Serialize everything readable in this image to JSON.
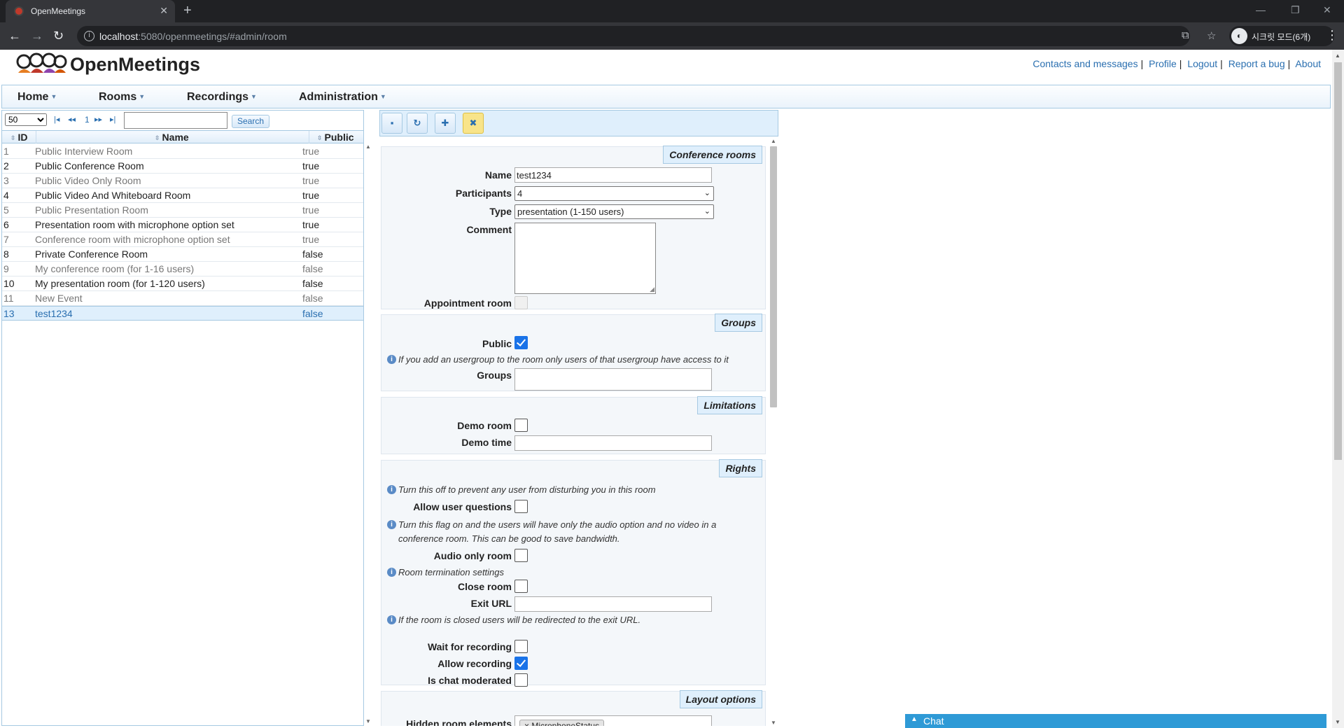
{
  "browser": {
    "tab_title": "OpenMeetings",
    "url_host": "localhost",
    "url_rest": ":5080/openmeetings/#admin/room",
    "profile_label": "시크릿 모드(6개)"
  },
  "app": {
    "logo_text": "OpenMeetings",
    "top_links": [
      "Contacts and messages",
      "Profile",
      "Logout",
      "Report a bug",
      "About"
    ],
    "menu": [
      "Home",
      "Rooms",
      "Recordings",
      "Administration"
    ]
  },
  "grid": {
    "page_size": "50",
    "page_number": "1",
    "search_value": "",
    "search_label": "Search",
    "columns": {
      "id": "ID",
      "name": "Name",
      "public": "Public"
    },
    "rows": [
      {
        "id": "1",
        "name": "Public Interview Room",
        "public": "true",
        "dim": true
      },
      {
        "id": "2",
        "name": "Public Conference Room",
        "public": "true",
        "dim": false
      },
      {
        "id": "3",
        "name": "Public Video Only Room",
        "public": "true",
        "dim": true
      },
      {
        "id": "4",
        "name": "Public Video And Whiteboard Room",
        "public": "true",
        "dim": false
      },
      {
        "id": "5",
        "name": "Public Presentation Room",
        "public": "true",
        "dim": true
      },
      {
        "id": "6",
        "name": "Presentation room with microphone option set",
        "public": "true",
        "dim": false
      },
      {
        "id": "7",
        "name": "Conference room with microphone option set",
        "public": "true",
        "dim": true
      },
      {
        "id": "8",
        "name": "Private Conference Room",
        "public": "false",
        "dim": false
      },
      {
        "id": "9",
        "name": "My conference room (for 1-16 users)",
        "public": "false",
        "dim": true
      },
      {
        "id": "10",
        "name": "My presentation room (for 1-120 users)",
        "public": "false",
        "dim": false
      },
      {
        "id": "11",
        "name": "New Event",
        "public": "false",
        "dim": true
      },
      {
        "id": "13",
        "name": "test1234",
        "public": "false",
        "dim": false,
        "selected": true
      }
    ]
  },
  "form": {
    "sections": {
      "conference": "Conference rooms",
      "groups": "Groups",
      "limitations": "Limitations",
      "rights": "Rights",
      "layout": "Layout options"
    },
    "labels": {
      "name": "Name",
      "participants": "Participants",
      "type": "Type",
      "comment": "Comment",
      "appointment": "Appointment room",
      "public": "Public",
      "groups": "Groups",
      "demo_room": "Demo room",
      "demo_time": "Demo time",
      "allow_questions": "Allow user questions",
      "audio_only": "Audio only room",
      "close_room": "Close room",
      "exit_url": "Exit URL",
      "wait_recording": "Wait for recording",
      "allow_recording": "Allow recording",
      "chat_moderated": "Is chat moderated",
      "hidden_elements": "Hidden room elements"
    },
    "values": {
      "name": "test1234",
      "participants": "4",
      "type": "presentation (1-150 users)",
      "hidden_tag": "× MicrophoneStatus"
    },
    "hints": {
      "groups": "If you add an usergroup to the room only users of that usergroup have access to it",
      "questions": "Turn this off to prevent any user from disturbing you in this room",
      "audio": "Turn this flag on and the users will have only the audio option and no video in a conference room. This can be good to save bandwidth.",
      "termination": "Room termination settings",
      "exit": "If the room is closed users will be redirected to the exit URL."
    },
    "checkboxes": {
      "appointment": false,
      "public": true,
      "demo_room": false,
      "allow_questions": false,
      "audio_only": false,
      "close_room": false,
      "wait_recording": false,
      "allow_recording": true,
      "chat_moderated": false
    }
  },
  "chat": {
    "label": "Chat"
  },
  "colors": {
    "accent": "#2a6fb0",
    "selected_row": "#dfeffc",
    "chat_bar": "#2e9ad6",
    "checkbox_on": "#1a73e8"
  },
  "icons": {
    "toolbar": [
      "save-icon",
      "refresh-icon",
      "add-icon",
      "cancel-icon"
    ]
  }
}
